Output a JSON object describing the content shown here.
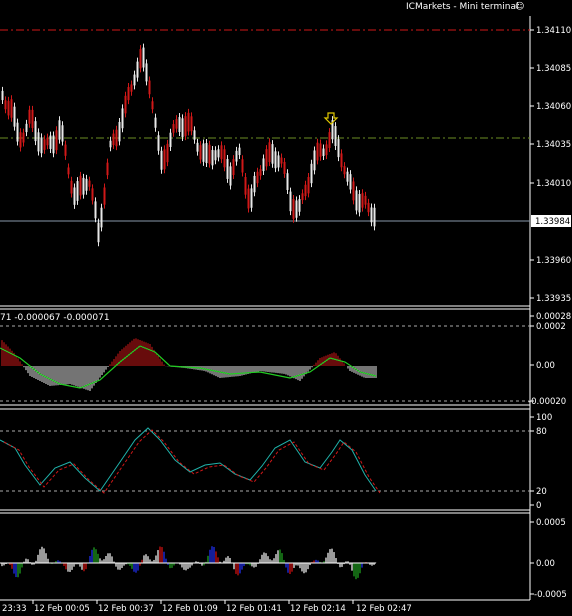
{
  "window": {
    "title": "ICMarkets - Mini terminal",
    "smiley": "☺"
  },
  "main_chart": {
    "price_ticks": [
      "1.34110",
      "1.34085",
      "1.34060",
      "1.34035",
      "1.34010",
      "1.33985",
      "1.33960",
      "1.33935"
    ],
    "current_price": "1.33984",
    "arrow_icon": "down-arrow-icon",
    "colors": {
      "bull": "#e8e8e8",
      "bear": "#d01818",
      "resistance_line": "#d01818",
      "pivot_line": "#6b8e23",
      "price_line": "#8899aa",
      "arrow": "#e0c800"
    }
  },
  "macd_panel": {
    "label": "71 -0.000067 -0.000071",
    "ticks": [
      "0.00028",
      "0.0002",
      "0.00",
      "-0.00020"
    ],
    "colors": {
      "signal": "#22cc22",
      "pos_hist": "#d01818",
      "neg_hist": "#e8e8e8"
    }
  },
  "stoch_panel": {
    "ticks": [
      "100",
      "80",
      "20",
      "0"
    ],
    "colors": {
      "main": "#20b2aa",
      "signal": "#d01818"
    }
  },
  "volume_panel": {
    "ticks": [
      "0.0005",
      "0.00",
      "-0.0005"
    ],
    "colors": {
      "white": "#ffffff",
      "red": "#dd1111",
      "blue": "#2233ff",
      "green": "#22aa22"
    }
  },
  "time_axis": {
    "labels": [
      "23:33",
      "12 Feb 00:05",
      "12 Feb 00:37",
      "12 Feb 01:09",
      "12 Feb 01:41",
      "12 Feb 02:14",
      "12 Feb 02:47"
    ]
  }
}
